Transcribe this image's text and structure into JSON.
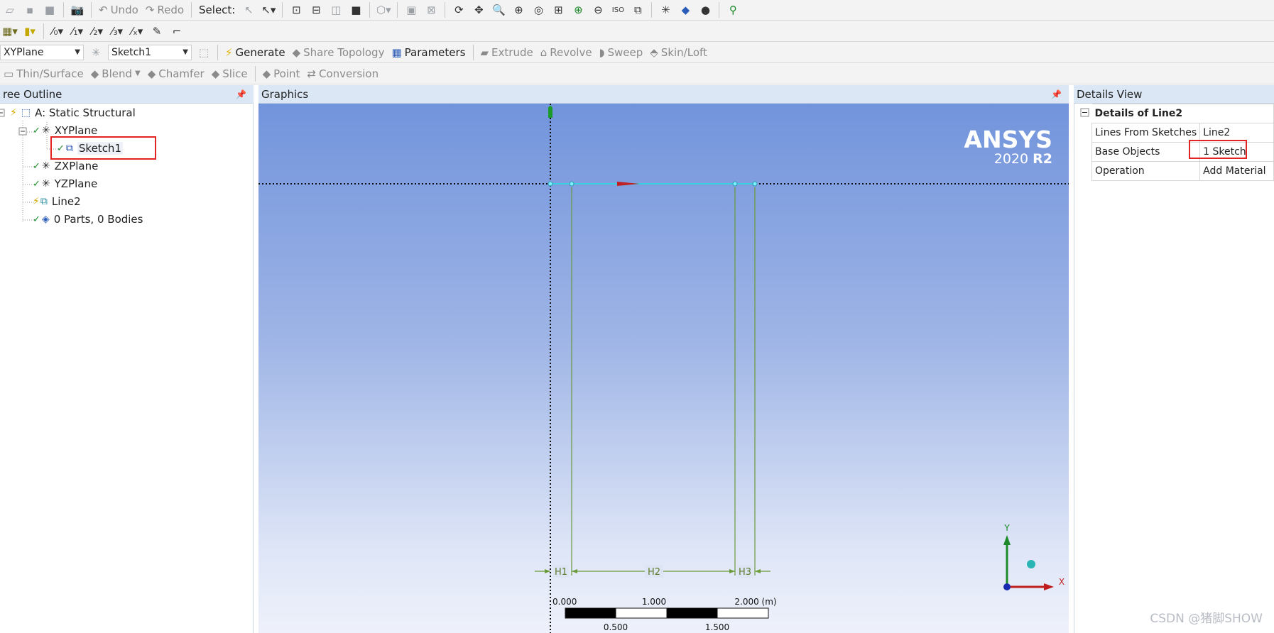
{
  "toolbar1": {
    "undo": "Undo",
    "redo": "Redo",
    "select_label": "Select:"
  },
  "toolbar3": {
    "plane_select": "XYPlane",
    "sketch_select": "Sketch1",
    "generate": "Generate",
    "share_topology": "Share Topology",
    "parameters": "Parameters",
    "extrude": "Extrude",
    "revolve": "Revolve",
    "sweep": "Sweep",
    "skin_loft": "Skin/Loft"
  },
  "toolbar4": {
    "thin_surface": "Thin/Surface",
    "blend": "Blend",
    "chamfer": "Chamfer",
    "slice": "Slice",
    "point": "Point",
    "conversion": "Conversion"
  },
  "tree": {
    "title": "ree Outline",
    "pin": "📌",
    "nodes": {
      "root": "A: Static Structural",
      "xyplane": "XYPlane",
      "sketch1": "Sketch1",
      "zxplane": "ZXPlane",
      "yzplane": "YZPlane",
      "line2": "Line2",
      "parts": "0 Parts, 0 Bodies"
    }
  },
  "graphics": {
    "title": "Graphics",
    "logo": "ANSYS",
    "version": "2020",
    "release": "R2",
    "dimensions": [
      "H1",
      "H2",
      "H3"
    ],
    "scale": {
      "top_labels": [
        "0.000",
        "1.000",
        "2.000 (m)"
      ],
      "bottom_labels": [
        "0.500",
        "1.500"
      ]
    },
    "triad": {
      "x": "X",
      "y": "Y"
    }
  },
  "details": {
    "title": "Details View",
    "section": "Details of Line2",
    "rows": [
      {
        "label": "Lines From Sketches",
        "value": "Line2"
      },
      {
        "label": "Base Objects",
        "value": "1 Sketch"
      },
      {
        "label": "Operation",
        "value": "Add Material"
      }
    ]
  },
  "watermark": "CSDN @猪脚SHOW",
  "colors": {
    "panel_header": "#dbe7f5",
    "graphics_top": "#7294dc",
    "graphics_bottom": "#eef1fb",
    "sketch_line": "#6a9a3a",
    "highlight_box": "#e32222"
  }
}
